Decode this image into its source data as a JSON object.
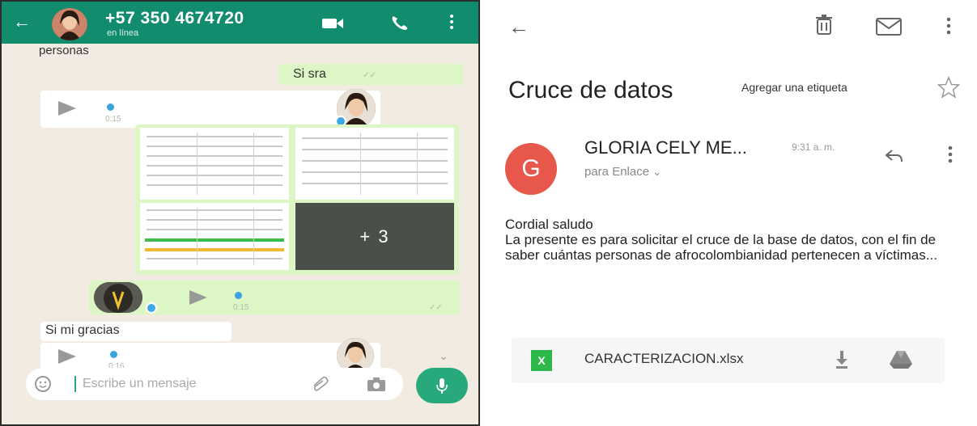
{
  "chat": {
    "contact_name": "+57 350 4674720",
    "contact_status": "en línea",
    "scroll_text": "personas",
    "messages": {
      "si_sra": "Si sra",
      "si_mi_gracias": "Si mi gracias"
    },
    "voice_notes": {
      "first_duration": "0:15",
      "second_duration": "0:15",
      "third_duration": "0:16"
    },
    "image_more": "+ 3",
    "input_placeholder": "Escribe un mensaje"
  },
  "email": {
    "subject": "Cruce de datos",
    "label_button": "Agregar una etiqueta",
    "sender_initial": "G",
    "sender_name": "GLORIA CELY ME...",
    "sent_time": "9:31 a. m.",
    "recipient": "para Enlace",
    "body": [
      "Cordial saludo",
      "La presente es para solicitar el cruce de la base de datos, con el fin de saber cuántas personas de afrocolombianidad pertenecen a víctimas..."
    ],
    "attachment": {
      "name": "CARACTERIZACION.xlsx",
      "type_label": "X"
    }
  },
  "colors": {
    "chat_header": "#128c6f",
    "chat_bg": "#f2ebe1",
    "outgoing_bubble": "#dcf7c5",
    "sender_avatar": "#e8574c",
    "excel_green": "#2fb84a",
    "mic_button": "#27a97c"
  },
  "icons": [
    "back-arrow-icon",
    "video-call-icon",
    "phone-icon",
    "more-vert-icon",
    "play-icon",
    "emoji-icon",
    "attach-icon",
    "camera-icon",
    "mic-icon",
    "trash-icon",
    "mail-icon",
    "star-icon",
    "reply-icon",
    "chevron-down-icon",
    "download-icon",
    "drive-icon",
    "excel-icon"
  ]
}
